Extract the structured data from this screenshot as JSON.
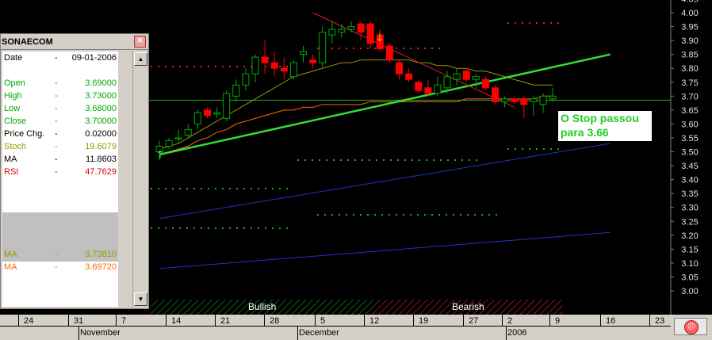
{
  "data_window": {
    "title": "SONAECOM",
    "close_icon": "close-icon",
    "rows": [
      {
        "label": "Date",
        "sep": "-",
        "value": "09-01-2006",
        "color": "#000000"
      },
      {
        "label": "Open",
        "sep": "-",
        "value": "3.69000",
        "color": "#00aa00"
      },
      {
        "label": "High",
        "sep": "-",
        "value": "3.73000",
        "color": "#00aa00"
      },
      {
        "label": "Low",
        "sep": "-",
        "value": "3.68000",
        "color": "#00aa00"
      },
      {
        "label": "Close",
        "sep": "-",
        "value": "3.70000",
        "color": "#00aa00"
      },
      {
        "label": "Price Chg.",
        "sep": "-",
        "value": "0.02000",
        "color": "#000000"
      },
      {
        "label": "Stoch",
        "sep": "-",
        "value": "19.6079",
        "color": "#999900"
      },
      {
        "label": "MA",
        "sep": "-",
        "value": "11.8603",
        "color": "#000000"
      },
      {
        "label": "RSI",
        "sep": "-",
        "value": "47.7629",
        "color": "#dd0000"
      },
      {
        "label": "MA",
        "sep": "-",
        "value": "3.73810",
        "color": "#999900"
      },
      {
        "label": "MA",
        "sep": "-",
        "value": "3.69720",
        "color": "#ff6600"
      }
    ]
  },
  "annotation": {
    "line1": "O Stop passou",
    "line2": "para 3.66"
  },
  "sentiment": {
    "bullish": "Bullish",
    "bearish": "Bearish"
  },
  "date_axis": {
    "days": [
      "24",
      "31",
      "7",
      "14",
      "21",
      "28",
      "5",
      "12",
      "19",
      "27",
      "2",
      "9",
      "16",
      "23"
    ],
    "months": [
      "November",
      "December",
      "2006"
    ]
  },
  "colors": {
    "up": "#00aa00",
    "down": "#ff0000",
    "trend_green": "#33dd33",
    "channel_blue": "#2233cc",
    "resist_red": "#dd2222",
    "ma_olive": "#999900",
    "ma_orange": "#ff6600",
    "level_line": "#22aa22"
  },
  "chart_data": {
    "type": "candlestick",
    "title": "",
    "ylim": [
      2.95,
      4.05
    ],
    "y_ticks": [
      "3.00",
      "3.05",
      "3.10",
      "3.15",
      "3.20",
      "3.25",
      "3.30",
      "3.35",
      "3.40",
      "3.45",
      "3.50",
      "3.55",
      "3.60",
      "3.65",
      "3.70",
      "3.75",
      "3.80",
      "3.85",
      "3.90",
      "3.95",
      "4.00",
      "4.05"
    ],
    "candles": [
      {
        "o": 3.5,
        "h": 3.54,
        "l": 3.47,
        "c": 3.52
      },
      {
        "o": 3.52,
        "h": 3.55,
        "l": 3.51,
        "c": 3.54
      },
      {
        "o": 3.55,
        "h": 3.58,
        "l": 3.53,
        "c": 3.55
      },
      {
        "o": 3.56,
        "h": 3.6,
        "l": 3.55,
        "c": 3.58
      },
      {
        "o": 3.6,
        "h": 3.65,
        "l": 3.58,
        "c": 3.64
      },
      {
        "o": 3.65,
        "h": 3.66,
        "l": 3.62,
        "c": 3.63
      },
      {
        "o": 3.64,
        "h": 3.66,
        "l": 3.62,
        "c": 3.64
      },
      {
        "o": 3.62,
        "h": 3.72,
        "l": 3.61,
        "c": 3.71
      },
      {
        "o": 3.7,
        "h": 3.76,
        "l": 3.68,
        "c": 3.74
      },
      {
        "o": 3.74,
        "h": 3.8,
        "l": 3.72,
        "c": 3.78
      },
      {
        "o": 3.78,
        "h": 3.85,
        "l": 3.75,
        "c": 3.84
      },
      {
        "o": 3.84,
        "h": 3.9,
        "l": 3.78,
        "c": 3.82
      },
      {
        "o": 3.82,
        "h": 3.86,
        "l": 3.77,
        "c": 3.8
      },
      {
        "o": 3.8,
        "h": 3.84,
        "l": 3.76,
        "c": 3.79
      },
      {
        "o": 3.77,
        "h": 3.83,
        "l": 3.76,
        "c": 3.82
      },
      {
        "o": 3.85,
        "h": 3.88,
        "l": 3.82,
        "c": 3.86
      },
      {
        "o": 3.83,
        "h": 3.85,
        "l": 3.8,
        "c": 3.82
      },
      {
        "o": 3.82,
        "h": 3.95,
        "l": 3.8,
        "c": 3.93
      },
      {
        "o": 3.92,
        "h": 3.97,
        "l": 3.89,
        "c": 3.94
      },
      {
        "o": 3.93,
        "h": 3.96,
        "l": 3.91,
        "c": 3.94
      },
      {
        "o": 3.94,
        "h": 3.97,
        "l": 3.93,
        "c": 3.95
      },
      {
        "o": 3.96,
        "h": 3.97,
        "l": 3.9,
        "c": 3.93
      },
      {
        "o": 3.96,
        "h": 3.97,
        "l": 3.87,
        "c": 3.89
      },
      {
        "o": 3.92,
        "h": 3.94,
        "l": 3.86,
        "c": 3.87
      },
      {
        "o": 3.88,
        "h": 3.89,
        "l": 3.82,
        "c": 3.83
      },
      {
        "o": 3.82,
        "h": 3.83,
        "l": 3.76,
        "c": 3.78
      },
      {
        "o": 3.78,
        "h": 3.8,
        "l": 3.75,
        "c": 3.76
      },
      {
        "o": 3.75,
        "h": 3.76,
        "l": 3.71,
        "c": 3.72
      },
      {
        "o": 3.73,
        "h": 3.76,
        "l": 3.7,
        "c": 3.71
      },
      {
        "o": 3.71,
        "h": 3.77,
        "l": 3.7,
        "c": 3.74
      },
      {
        "o": 3.73,
        "h": 3.79,
        "l": 3.71,
        "c": 3.77
      },
      {
        "o": 3.76,
        "h": 3.8,
        "l": 3.74,
        "c": 3.78
      },
      {
        "o": 3.79,
        "h": 3.8,
        "l": 3.75,
        "c": 3.76
      },
      {
        "o": 3.76,
        "h": 3.78,
        "l": 3.73,
        "c": 3.77
      },
      {
        "o": 3.76,
        "h": 3.77,
        "l": 3.72,
        "c": 3.73
      },
      {
        "o": 3.73,
        "h": 3.74,
        "l": 3.67,
        "c": 3.68
      },
      {
        "o": 3.68,
        "h": 3.7,
        "l": 3.66,
        "c": 3.69
      },
      {
        "o": 3.69,
        "h": 3.7,
        "l": 3.67,
        "c": 3.68
      },
      {
        "o": 3.69,
        "h": 3.7,
        "l": 3.62,
        "c": 3.67
      },
      {
        "o": 3.68,
        "h": 3.7,
        "l": 3.63,
        "c": 3.69
      },
      {
        "o": 3.67,
        "h": 3.71,
        "l": 3.64,
        "c": 3.7
      },
      {
        "o": 3.69,
        "h": 3.73,
        "l": 3.68,
        "c": 3.7
      }
    ],
    "moving_averages": [
      {
        "name": "MA",
        "color": "#999900",
        "values": [
          3.51,
          3.52,
          3.53,
          3.55,
          3.57,
          3.59,
          3.61,
          3.63,
          3.65,
          3.67,
          3.69,
          3.71,
          3.73,
          3.75,
          3.77,
          3.78,
          3.79,
          3.8,
          3.81,
          3.82,
          3.82,
          3.83,
          3.83,
          3.83,
          3.83,
          3.83,
          3.83,
          3.82,
          3.82,
          3.81,
          3.81,
          3.8,
          3.8,
          3.79,
          3.79,
          3.78,
          3.77,
          3.76,
          3.75,
          3.74,
          3.74,
          3.74
        ]
      },
      {
        "name": "MA",
        "color": "#ff6600",
        "values": [
          3.49,
          3.5,
          3.51,
          3.52,
          3.54,
          3.55,
          3.57,
          3.58,
          3.6,
          3.61,
          3.62,
          3.63,
          3.64,
          3.65,
          3.65,
          3.66,
          3.66,
          3.67,
          3.67,
          3.67,
          3.67,
          3.67,
          3.68,
          3.68,
          3.68,
          3.68,
          3.68,
          3.68,
          3.68,
          3.68,
          3.68,
          3.68,
          3.69,
          3.69,
          3.69,
          3.69,
          3.69,
          3.69,
          3.69,
          3.69,
          3.7,
          3.7
        ]
      }
    ],
    "horizontal_level": 3.66,
    "trend_lines": [
      {
        "name": "support",
        "color": "#33dd33",
        "from": {
          "x": 0,
          "y": 3.49
        },
        "to": {
          "x": 47,
          "y": 3.85
        }
      },
      {
        "name": "resistance",
        "color": "#dd2222",
        "from": {
          "x": 16,
          "y": 4.0
        },
        "to": {
          "x": 37,
          "y": 3.66
        }
      },
      {
        "name": "channel_upper",
        "color": "#2233cc",
        "from": {
          "x": 0,
          "y": 3.26
        },
        "to": {
          "x": 47,
          "y": 3.53
        }
      },
      {
        "name": "channel_lower",
        "color": "#2233cc",
        "from": {
          "x": 0,
          "y": 3.08
        },
        "to": {
          "x": 47,
          "y": 3.21
        }
      }
    ]
  }
}
